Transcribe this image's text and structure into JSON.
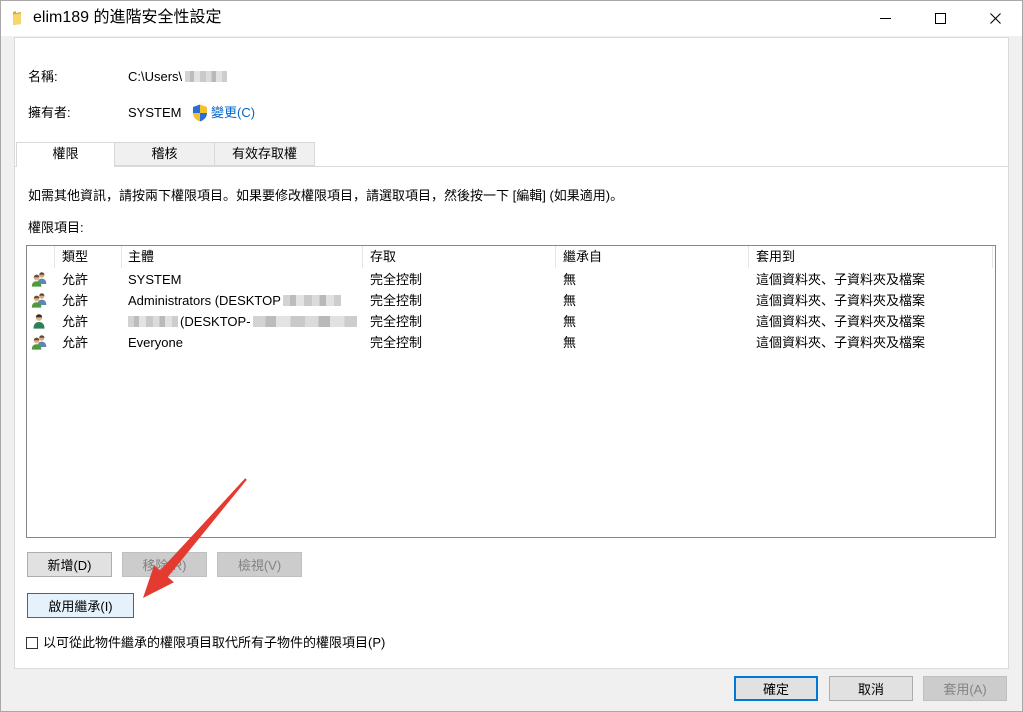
{
  "window": {
    "title": "elim189 的進階安全性設定",
    "icon": "folder-icon",
    "controls": [
      "minimize-icon",
      "maximize-icon",
      "close-icon"
    ]
  },
  "object": {
    "name_label": "名稱:",
    "name_value": "C:\\Users\\",
    "owner_label": "擁有者:",
    "owner_value": "SYSTEM",
    "owner_icon": "uac-shield-icon",
    "change_link": "變更(C)"
  },
  "tabs": [
    {
      "label": "權限",
      "selected": true
    },
    {
      "label": "稽核",
      "selected": false
    },
    {
      "label": "有效存取權",
      "selected": false
    }
  ],
  "permissions": {
    "instructions": "如需其他資訊，請按兩下權限項目。如果要修改權限項目，請選取項目，然後按一下 [編輯] (如果適用)。",
    "entries_label": "權限項目:",
    "columns": [
      "類型",
      "主體",
      "存取",
      "繼承自",
      "套用到"
    ],
    "rows": [
      {
        "icon": "group-icon",
        "type": "允許",
        "principal": "SYSTEM",
        "access": "完全控制",
        "inherited_from": "無",
        "applies_to": "這個資料夾、子資料夾及檔案"
      },
      {
        "icon": "group-icon",
        "type": "允許",
        "principal": "Administrators (DESKTOP",
        "access": "完全控制",
        "inherited_from": "無",
        "applies_to": "這個資料夾、子資料夾及檔案"
      },
      {
        "icon": "user-icon",
        "type": "允許",
        "principal": "(DESKTOP-",
        "access": "完全控制",
        "inherited_from": "無",
        "applies_to": "這個資料夾、子資料夾及檔案"
      },
      {
        "icon": "group-icon",
        "type": "允許",
        "principal": "Everyone",
        "access": "完全控制",
        "inherited_from": "無",
        "applies_to": "這個資料夾、子資料夾及檔案"
      }
    ],
    "buttons": {
      "add": {
        "label": "新增(D)",
        "enabled": true
      },
      "remove": {
        "label": "移除(R)",
        "enabled": false
      },
      "view": {
        "label": "檢視(V)",
        "enabled": false
      }
    },
    "enable_inheritance": "啟用繼承(I)",
    "replace_child_entries": {
      "label": "以可從此物件繼承的權限項目取代所有子物件的權限項目(P)",
      "checked": false
    }
  },
  "footer": {
    "ok": {
      "label": "確定",
      "enabled": true
    },
    "cancel": {
      "label": "取消",
      "enabled": true
    },
    "apply": {
      "label": "套用(A)",
      "enabled": false
    }
  },
  "colors": {
    "link": "#0066cc",
    "focus_border": "#0078d7",
    "annotation_arrow": "#e53a2f"
  }
}
